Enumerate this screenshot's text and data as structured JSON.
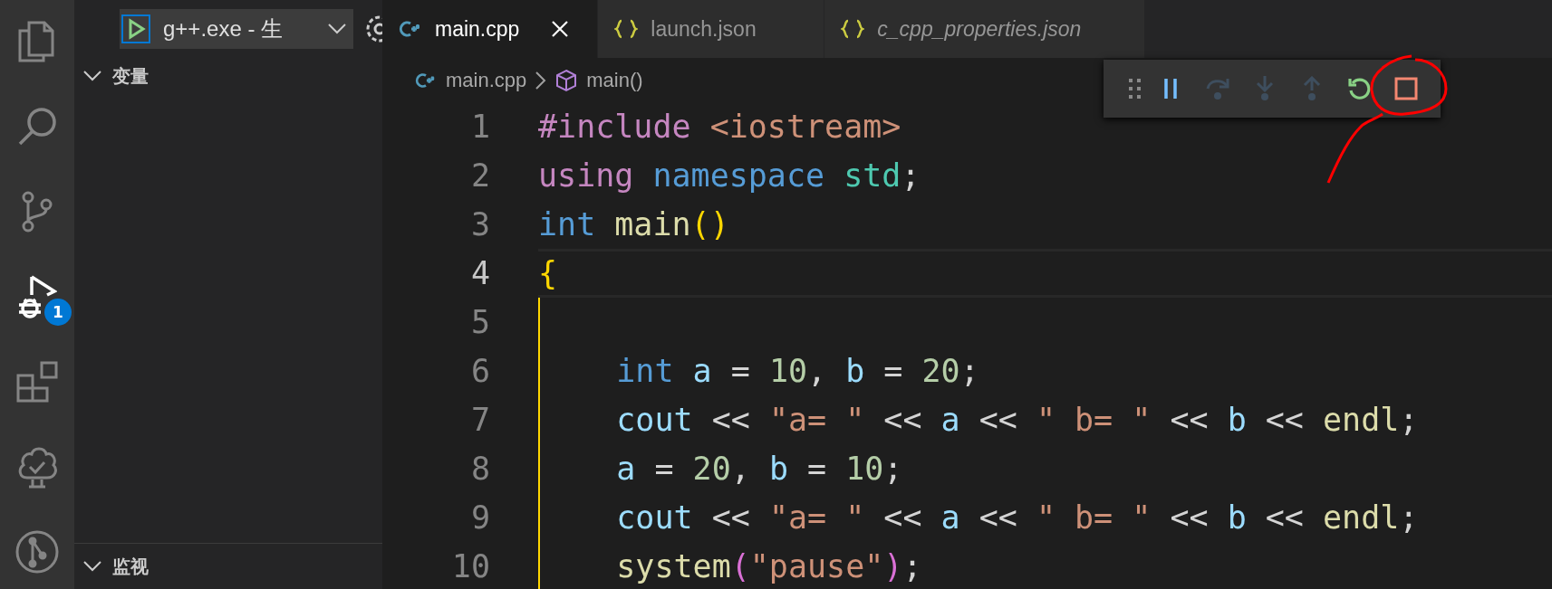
{
  "activity_bar": [
    {
      "kind": "files",
      "selected": false
    },
    {
      "kind": "search",
      "selected": false
    },
    {
      "kind": "source-control",
      "selected": false
    },
    {
      "kind": "debug",
      "selected": true,
      "badge": "1"
    },
    {
      "kind": "extensions",
      "selected": false
    },
    {
      "kind": "tree",
      "selected": false
    },
    {
      "kind": "git-graph",
      "selected": false
    }
  ],
  "sidebar": {
    "debug_config": "g++.exe - 生",
    "sections": [
      {
        "title": "变量",
        "expanded": true
      },
      {
        "title": "监视",
        "expanded": true
      }
    ]
  },
  "tabs": [
    {
      "label": "main.cpp",
      "kind": "cpp",
      "selected": true,
      "preview": false
    },
    {
      "label": "launch.json",
      "kind": "json",
      "selected": false,
      "preview": false
    },
    {
      "label": "c_cpp_properties.json",
      "kind": "json",
      "selected": false,
      "preview": true
    }
  ],
  "breadcrumb": [
    {
      "label": "main.cpp",
      "kind": "cpp"
    },
    {
      "label": "main()",
      "kind": "symbol"
    }
  ],
  "debug_toolbar": [
    {
      "kind": "grip",
      "disabled": false
    },
    {
      "kind": "pause",
      "disabled": false
    },
    {
      "kind": "step-over",
      "disabled": true
    },
    {
      "kind": "step-into",
      "disabled": true
    },
    {
      "kind": "step-out",
      "disabled": true
    },
    {
      "kind": "restart",
      "disabled": false
    },
    {
      "kind": "stop",
      "disabled": false
    }
  ],
  "code": [
    {
      "number": "1",
      "current": false,
      "bracket_guide": false,
      "tokens": [
        {
          "text": "#include",
          "color": "#c586c0"
        },
        {
          "text": " <iostream>",
          "color": "#ce9178"
        }
      ]
    },
    {
      "number": "2",
      "current": false,
      "bracket_guide": false,
      "tokens": [
        {
          "text": "using",
          "color": "#c586c0"
        },
        {
          "text": " namespace",
          "color": "#569cd6"
        },
        {
          "text": " std",
          "color": "#4ec9b0"
        },
        {
          "text": ";",
          "color": "#d4d4d4"
        }
      ]
    },
    {
      "number": "3",
      "current": false,
      "bracket_guide": false,
      "tokens": [
        {
          "text": "int",
          "color": "#569cd6"
        },
        {
          "text": " main",
          "color": "#dcdcaa"
        },
        {
          "text": "()",
          "color": "#ffd700"
        }
      ]
    },
    {
      "number": "4",
      "current": true,
      "bracket_guide": false,
      "tokens": [
        {
          "text": "{",
          "color": "#ffd700"
        }
      ]
    },
    {
      "number": "5",
      "current": false,
      "bracket_guide": true
    },
    {
      "number": "6",
      "current": false,
      "bracket_guide": true,
      "tokens": [
        {
          "text": "    int",
          "color": "#569cd6"
        },
        {
          "text": " a",
          "color": "#9cdcfe"
        },
        {
          "text": " = ",
          "color": "#d4d4d4"
        },
        {
          "text": "10",
          "color": "#b5cea8"
        },
        {
          "text": ", ",
          "color": "#d4d4d4"
        },
        {
          "text": "b",
          "color": "#9cdcfe"
        },
        {
          "text": " = ",
          "color": "#d4d4d4"
        },
        {
          "text": "20",
          "color": "#b5cea8"
        },
        {
          "text": ";",
          "color": "#d4d4d4"
        }
      ]
    },
    {
      "number": "7",
      "current": false,
      "bracket_guide": true,
      "tokens": [
        {
          "text": "    cout",
          "color": "#9cdcfe"
        },
        {
          "text": " << ",
          "color": "#d4d4d4"
        },
        {
          "text": "\"a= \"",
          "color": "#ce9178"
        },
        {
          "text": " << ",
          "color": "#d4d4d4"
        },
        {
          "text": "a",
          "color": "#9cdcfe"
        },
        {
          "text": " << ",
          "color": "#d4d4d4"
        },
        {
          "text": "\" b= \"",
          "color": "#ce9178"
        },
        {
          "text": " << ",
          "color": "#d4d4d4"
        },
        {
          "text": "b",
          "color": "#9cdcfe"
        },
        {
          "text": " << ",
          "color": "#d4d4d4"
        },
        {
          "text": "endl",
          "color": "#dcdcaa"
        },
        {
          "text": ";",
          "color": "#d4d4d4"
        }
      ]
    },
    {
      "number": "8",
      "current": false,
      "bracket_guide": true,
      "tokens": [
        {
          "text": "    a",
          "color": "#9cdcfe"
        },
        {
          "text": " = ",
          "color": "#d4d4d4"
        },
        {
          "text": "20",
          "color": "#b5cea8"
        },
        {
          "text": ", ",
          "color": "#d4d4d4"
        },
        {
          "text": "b",
          "color": "#9cdcfe"
        },
        {
          "text": " = ",
          "color": "#d4d4d4"
        },
        {
          "text": "10",
          "color": "#b5cea8"
        },
        {
          "text": ";",
          "color": "#d4d4d4"
        }
      ]
    },
    {
      "number": "9",
      "current": false,
      "bracket_guide": true,
      "tokens": [
        {
          "text": "    cout",
          "color": "#9cdcfe"
        },
        {
          "text": " << ",
          "color": "#d4d4d4"
        },
        {
          "text": "\"a= \"",
          "color": "#ce9178"
        },
        {
          "text": " << ",
          "color": "#d4d4d4"
        },
        {
          "text": "a",
          "color": "#9cdcfe"
        },
        {
          "text": " << ",
          "color": "#d4d4d4"
        },
        {
          "text": "\" b= \"",
          "color": "#ce9178"
        },
        {
          "text": " << ",
          "color": "#d4d4d4"
        },
        {
          "text": "b",
          "color": "#9cdcfe"
        },
        {
          "text": " << ",
          "color": "#d4d4d4"
        },
        {
          "text": "endl",
          "color": "#dcdcaa"
        },
        {
          "text": ";",
          "color": "#d4d4d4"
        }
      ]
    },
    {
      "number": "10",
      "current": false,
      "bracket_guide": true,
      "tokens": [
        {
          "text": "    system",
          "color": "#dcdcaa"
        },
        {
          "text": "(",
          "color": "#da70d6"
        },
        {
          "text": "\"pause\"",
          "color": "#ce9178"
        },
        {
          "text": ")",
          "color": "#da70d6"
        },
        {
          "text": ";",
          "color": "#d4d4d4"
        }
      ]
    }
  ]
}
